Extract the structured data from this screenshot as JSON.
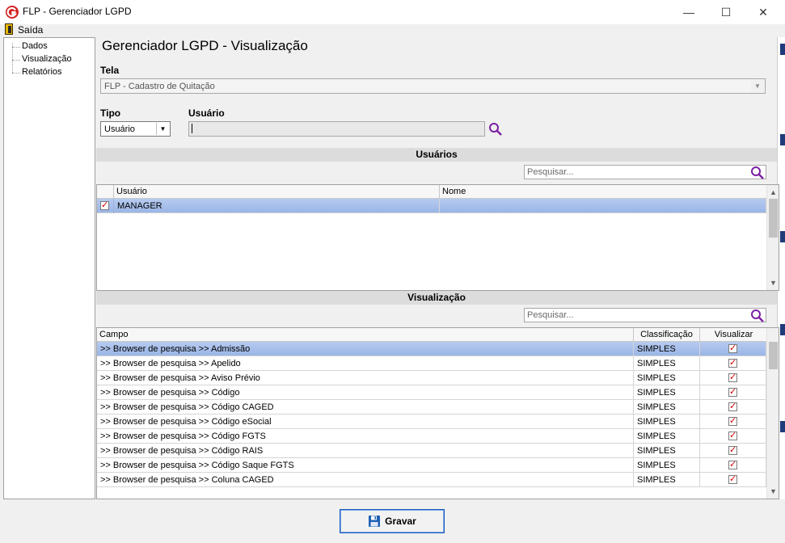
{
  "window": {
    "title": "FLP - Gerenciador LGPD",
    "minimize_glyph": "—",
    "maximize_glyph": "☐",
    "close_glyph": "✕"
  },
  "menu": {
    "exit_label": "Saída"
  },
  "tree": {
    "items": [
      "Dados",
      "Visualização",
      "Relatórios"
    ]
  },
  "main": {
    "title": "Gerenciador LGPD - Visualização",
    "tela_label": "Tela",
    "tela_value": "FLP - Cadastro de Quitação",
    "tipo_label": "Tipo",
    "tipo_value": "Usuário",
    "usuario_label": "Usuário",
    "usuario_value": ""
  },
  "users_section": {
    "header": "Usuários",
    "search_placeholder": "Pesquisar...",
    "columns": [
      "Usuário",
      "Nome"
    ],
    "rows": [
      {
        "usuario": "MANAGER",
        "nome": ""
      }
    ]
  },
  "view_section": {
    "header": "Visualização",
    "search_placeholder": "Pesquisar...",
    "columns": [
      "Campo",
      "Classificação",
      "Visualizar"
    ],
    "rows": [
      {
        "campo": ">> Browser de pesquisa >> Admissão",
        "classificacao": "SIMPLES"
      },
      {
        "campo": ">> Browser de pesquisa >> Apelido",
        "classificacao": "SIMPLES"
      },
      {
        "campo": ">> Browser de pesquisa >> Aviso Prévio",
        "classificacao": "SIMPLES"
      },
      {
        "campo": ">> Browser de pesquisa >> Código",
        "classificacao": "SIMPLES"
      },
      {
        "campo": ">> Browser de pesquisa >> Código CAGED",
        "classificacao": "SIMPLES"
      },
      {
        "campo": ">> Browser de pesquisa >> Código eSocial",
        "classificacao": "SIMPLES"
      },
      {
        "campo": ">> Browser de pesquisa >> Código FGTS",
        "classificacao": "SIMPLES"
      },
      {
        "campo": ">> Browser de pesquisa >> Código RAIS",
        "classificacao": "SIMPLES"
      },
      {
        "campo": ">> Browser de pesquisa >> Código Saque FGTS",
        "classificacao": "SIMPLES"
      },
      {
        "campo": ">> Browser de pesquisa >> Coluna CAGED",
        "classificacao": "SIMPLES"
      }
    ]
  },
  "footer": {
    "save_label": "Gravar"
  },
  "colors": {
    "selection": "#9ab5e6",
    "accent_search": "#7b1fa2",
    "check_red": "#d00000",
    "app_icon": "#d42020"
  }
}
